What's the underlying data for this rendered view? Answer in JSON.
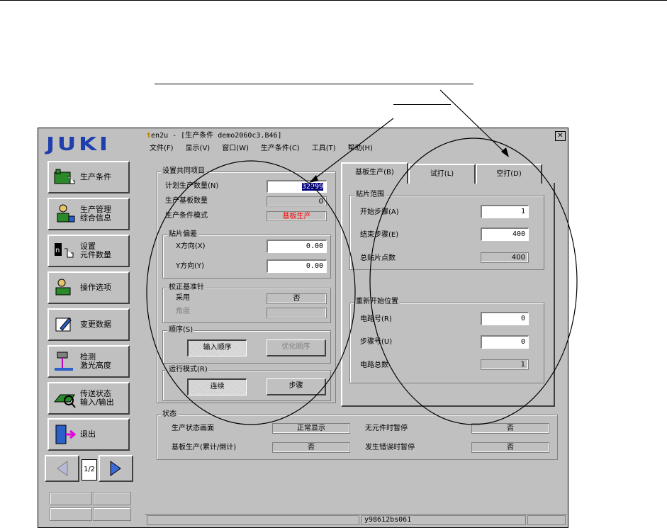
{
  "window": {
    "title": "en2u - [生产条件 demo2060c3.B46]",
    "close_glyph": "✕"
  },
  "logo": "JUKI",
  "menu": [
    "文件(F)",
    "显示(V)",
    "窗口(W)",
    "生产条件(C)",
    "工具(T)",
    "帮助(H)"
  ],
  "sidebar": {
    "buttons": [
      {
        "label": "生产条件",
        "icon": "factory-icon"
      },
      {
        "label": "生产管理\n综合信息",
        "icon": "chart-icon"
      },
      {
        "label": "设置\n元件数量",
        "icon": "component-icon"
      },
      {
        "label": "操作选项",
        "icon": "operator-icon"
      },
      {
        "label": "变更数据",
        "icon": "edit-icon"
      },
      {
        "label": "检测\n激光高度",
        "icon": "laser-icon"
      },
      {
        "label": "传送状态\n输入/输出",
        "icon": "conveyor-icon"
      },
      {
        "label": "退出",
        "icon": "exit-door-icon"
      }
    ],
    "page_indicator": "1/2"
  },
  "common": {
    "title": "设置共同项目",
    "plan_qty_label": "计划生产数量(N)",
    "plan_qty_value": "32999",
    "produced_label": "生产基板数量",
    "produced_value": "0",
    "mode_label": "生产条件模式",
    "mode_value": "基板生产",
    "offset": {
      "title": "贴片偏差",
      "x_label": "X方向(X)",
      "x_value": "0.00",
      "y_label": "Y方向(Y)",
      "y_value": "0.00"
    },
    "pin": {
      "title": "校正基准针",
      "use_label": "采用",
      "use_value": "否",
      "angle_label": "角度",
      "angle_value": ""
    },
    "order": {
      "title": "顺序(S)",
      "input_order": "输入顺序",
      "optimize_order": "优化顺序"
    },
    "run_mode": {
      "title": "运行模式(R)",
      "continuous": "连续",
      "step": "步骤"
    }
  },
  "tabs": [
    "基板生产(B)",
    "试打(L)",
    "空打(D)"
  ],
  "range": {
    "title": "贴片范围",
    "start_label": "开始步骤(A)",
    "start_value": "1",
    "end_label": "结束步骤(E)",
    "end_value": "400",
    "total_label": "总贴片点数",
    "total_value": "400"
  },
  "restart": {
    "title": "重新开始位置",
    "circuit_label": "电路号(R)",
    "circuit_value": "0",
    "step_label": "步骤号(U)",
    "step_value": "0",
    "total_circuits_label": "电路总数",
    "total_circuits_value": "1"
  },
  "status_group": {
    "title": "状态",
    "screen_label": "生产状态画面",
    "screen_value": "正常显示",
    "board_label": "基板生产(累计/倒计)",
    "board_value": "否",
    "no_part_label": "无元件时暂停",
    "no_part_value": "否",
    "error_label": "发生错误时暂停",
    "error_value": "否"
  },
  "statusbar": {
    "code": "y98612bs061"
  }
}
